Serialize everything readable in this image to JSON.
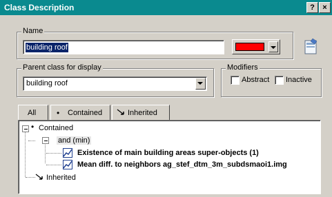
{
  "window": {
    "title": "Class Description",
    "help_button": "?",
    "close_button": "×"
  },
  "name_group": {
    "label": "Name",
    "value": "building roof",
    "color": "#ff0000"
  },
  "parent_group": {
    "label": "Parent class for display",
    "value": "building roof"
  },
  "modifiers": {
    "label": "Modifiers",
    "abstract_label": "Abstract",
    "inactive_label": "Inactive",
    "abstract_checked": false,
    "inactive_checked": false
  },
  "tabs": [
    {
      "label": "All"
    },
    {
      "label": "Contained"
    },
    {
      "label": "Inherited"
    }
  ],
  "tree": {
    "contained": "Contained",
    "and_node": "and (min)",
    "item1": "Existence of main building areas super-objects  (1)",
    "item2": "Mean diff. to neighbors ag_stef_dtm_3m_subdsmaoi1.img",
    "inherited": "Inherited"
  }
}
